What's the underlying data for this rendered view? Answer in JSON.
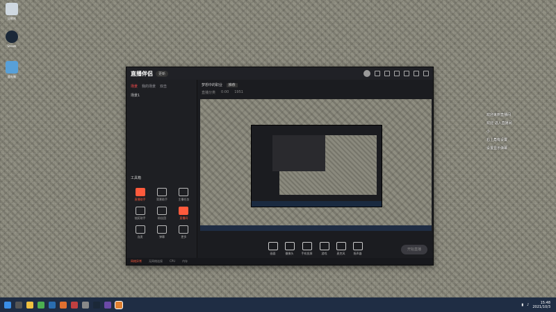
{
  "desktop": {
    "icons": [
      {
        "label": "回收站"
      },
      {
        "label": "Steam"
      },
      {
        "label": "此电脑"
      }
    ]
  },
  "app": {
    "logo": "直播伴侣",
    "badge": "更新",
    "left_tabs": [
      "场景",
      "我的场景",
      "双击"
    ],
    "scene_label": "场景1",
    "tools_title": "工具箱",
    "tools": [
      {
        "label": "直播助手",
        "highlight": true
      },
      {
        "label": "背景助手",
        "highlight": false
      },
      {
        "label": "主播任务",
        "highlight": false
      },
      {
        "label": "抽奖助手",
        "highlight": false
      },
      {
        "label": "粉丝团",
        "highlight": false
      },
      {
        "label": "直播间",
        "highlight": true
      },
      {
        "label": "连麦",
        "highlight": false
      },
      {
        "label": "弹幕",
        "highlight": false
      },
      {
        "label": "更多",
        "highlight": false
      }
    ],
    "main_header": {
      "title": "梦想中的职业",
      "tag": "推荐",
      "sub": [
        "直播分类",
        "0:00",
        "1951"
      ]
    },
    "bottom_buttons": [
      "画面",
      "摄像头",
      "手机投屏",
      "游戏",
      "麦克风",
      "扬声器"
    ],
    "start_button": "开始直播",
    "status": [
      "无网络连接",
      "CPU",
      "内存"
    ],
    "status_warn": "网络异常"
  },
  "chat": {
    "lines": [
      "欢迎来到直播间",
      "欢迎 进入直播间",
      "",
      "",
      "小",
      "右上角有设置",
      "设置显示弹幕",
      "",
      "",
      "",
      "",
      "",
      "",
      "",
      "",
      "",
      "",
      "",
      ""
    ]
  },
  "taskbar": {
    "time": "15:48",
    "date": "2021/10/3"
  },
  "colors": {
    "accent": "#ff5a3c",
    "taskbar": "#1f2d44"
  }
}
